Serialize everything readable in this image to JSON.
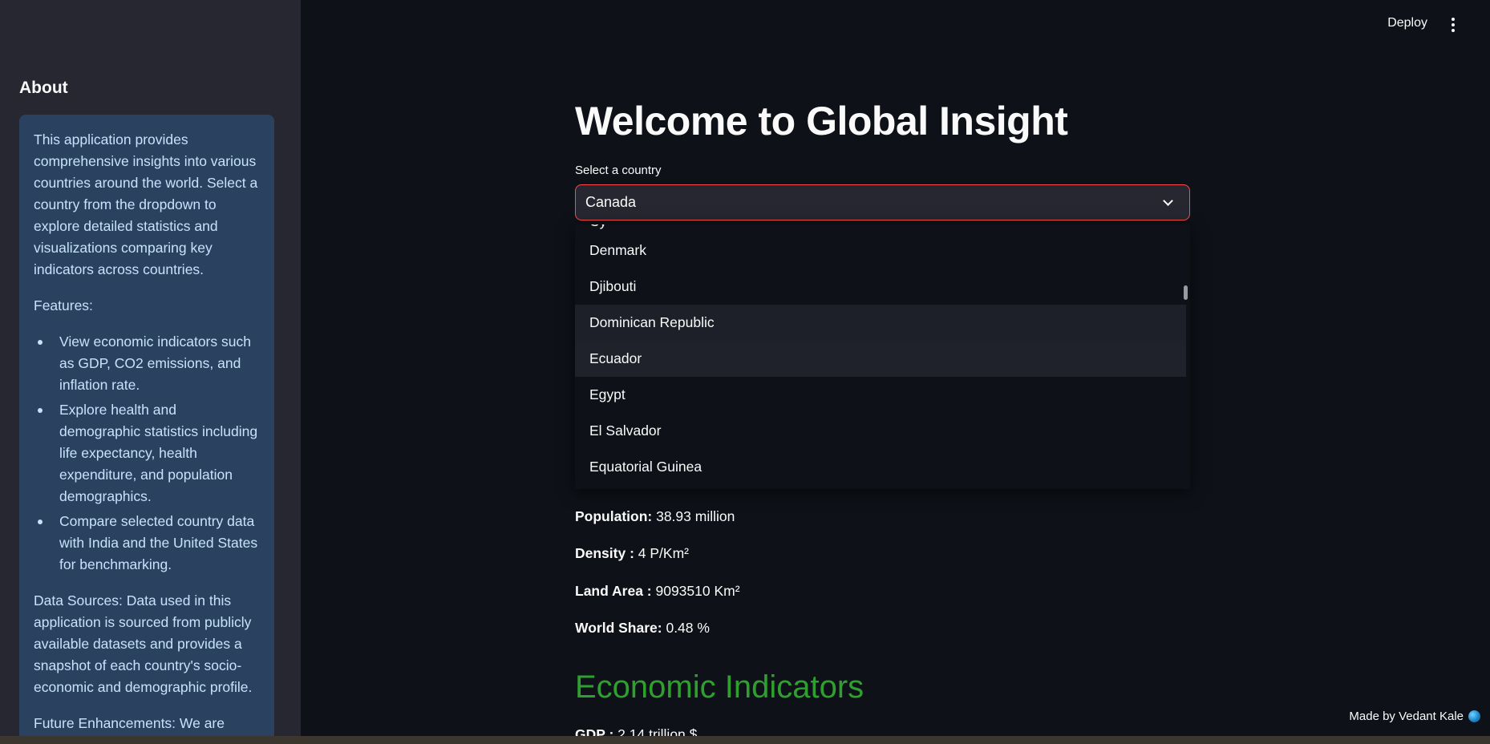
{
  "sidebar": {
    "title": "About",
    "intro": "This application provides comprehensive insights into various countries around the world. Select a country from the dropdown to explore detailed statistics and visualizations comparing key indicators across countries.",
    "features_heading": "Features:",
    "features": [
      "View economic indicators such as GDP, CO2 emissions, and inflation rate.",
      "Explore health and demographic statistics including life expectancy, health expenditure, and population demographics.",
      "Compare selected country data with India and the United States for benchmarking."
    ],
    "data_sources": "Data Sources: Data used in this application is sourced from publicly available datasets and provides a snapshot of each country's socio-economic and demographic profile.",
    "future": "Future Enhancements: We are continuously updating the"
  },
  "header": {
    "deploy_label": "Deploy"
  },
  "main": {
    "title": "Welcome to Global Insight",
    "select_label": "Select a country",
    "selected_country": "Canada",
    "dropdown_options": [
      "Denmark",
      "Djibouti",
      "Dominican Republic",
      "Ecuador",
      "Egypt",
      "El Salvador",
      "Equatorial Guinea"
    ],
    "stats": {
      "population_label": "Population:",
      "population_value": " 38.93 million",
      "density_label": "Density :",
      "density_value": " 4 P/Km²",
      "land_area_label": "Land Area :",
      "land_area_value": " 9093510 Km²",
      "world_share_label": "World Share:",
      "world_share_value": " 0.48 %"
    },
    "section_title": "Economic Indicators",
    "gdp_label": "GDP :",
    "gdp_value": " 2.14 trillion $"
  },
  "footer": {
    "credit": "Made by Vedant Kale"
  },
  "colors": {
    "background": "#0e1117",
    "sidebar": "#262730",
    "info_box": "#2b4160",
    "accent": "#ff4b4b",
    "section_title": "#2fa02f"
  }
}
